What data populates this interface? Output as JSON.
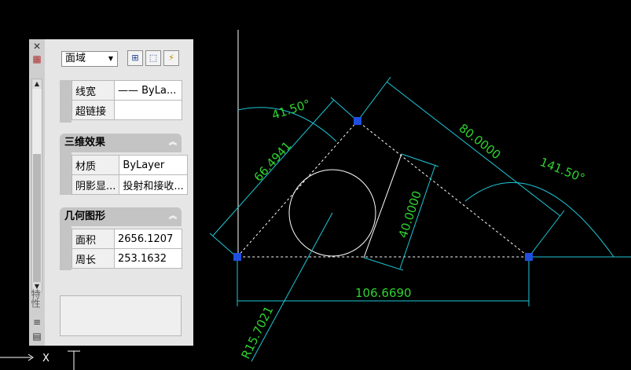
{
  "drawing": {
    "colors": {
      "background": "#000000",
      "line": "#ffffff",
      "dimension": "#1ec8d8",
      "dimension_text": "#2fd22f",
      "grip": "#1f4fe0"
    },
    "dimensions": {
      "angle_left": "41.50°",
      "side_left": "66.4941",
      "side_right": "80.0000",
      "angle_right": "141.50°",
      "height": "40.0000",
      "base": "106.6690",
      "radius": "R15.7021"
    },
    "ucs_label": "X"
  },
  "palette": {
    "object_type": "面域",
    "toolbar": {
      "quick_select_icon": "quick-select-icon",
      "select_objects_icon": "select-objects-icon",
      "toggle_pickadd_icon": "pickadd-icon"
    },
    "vertical_title": "特性",
    "rows_top": [
      {
        "name": "线宽",
        "value": "—— ByLa..."
      },
      {
        "name": "超链接",
        "value": ""
      }
    ],
    "section_3d": {
      "title": "三维效果",
      "rows": [
        {
          "name": "材质",
          "value": "ByLayer"
        },
        {
          "name": "阴影显...",
          "value": "投射和接收..."
        }
      ]
    },
    "section_geometry": {
      "title": "几何图形",
      "rows": [
        {
          "name": "面积",
          "value": "2656.1207"
        },
        {
          "name": "周长",
          "value": "253.1632"
        }
      ]
    }
  }
}
